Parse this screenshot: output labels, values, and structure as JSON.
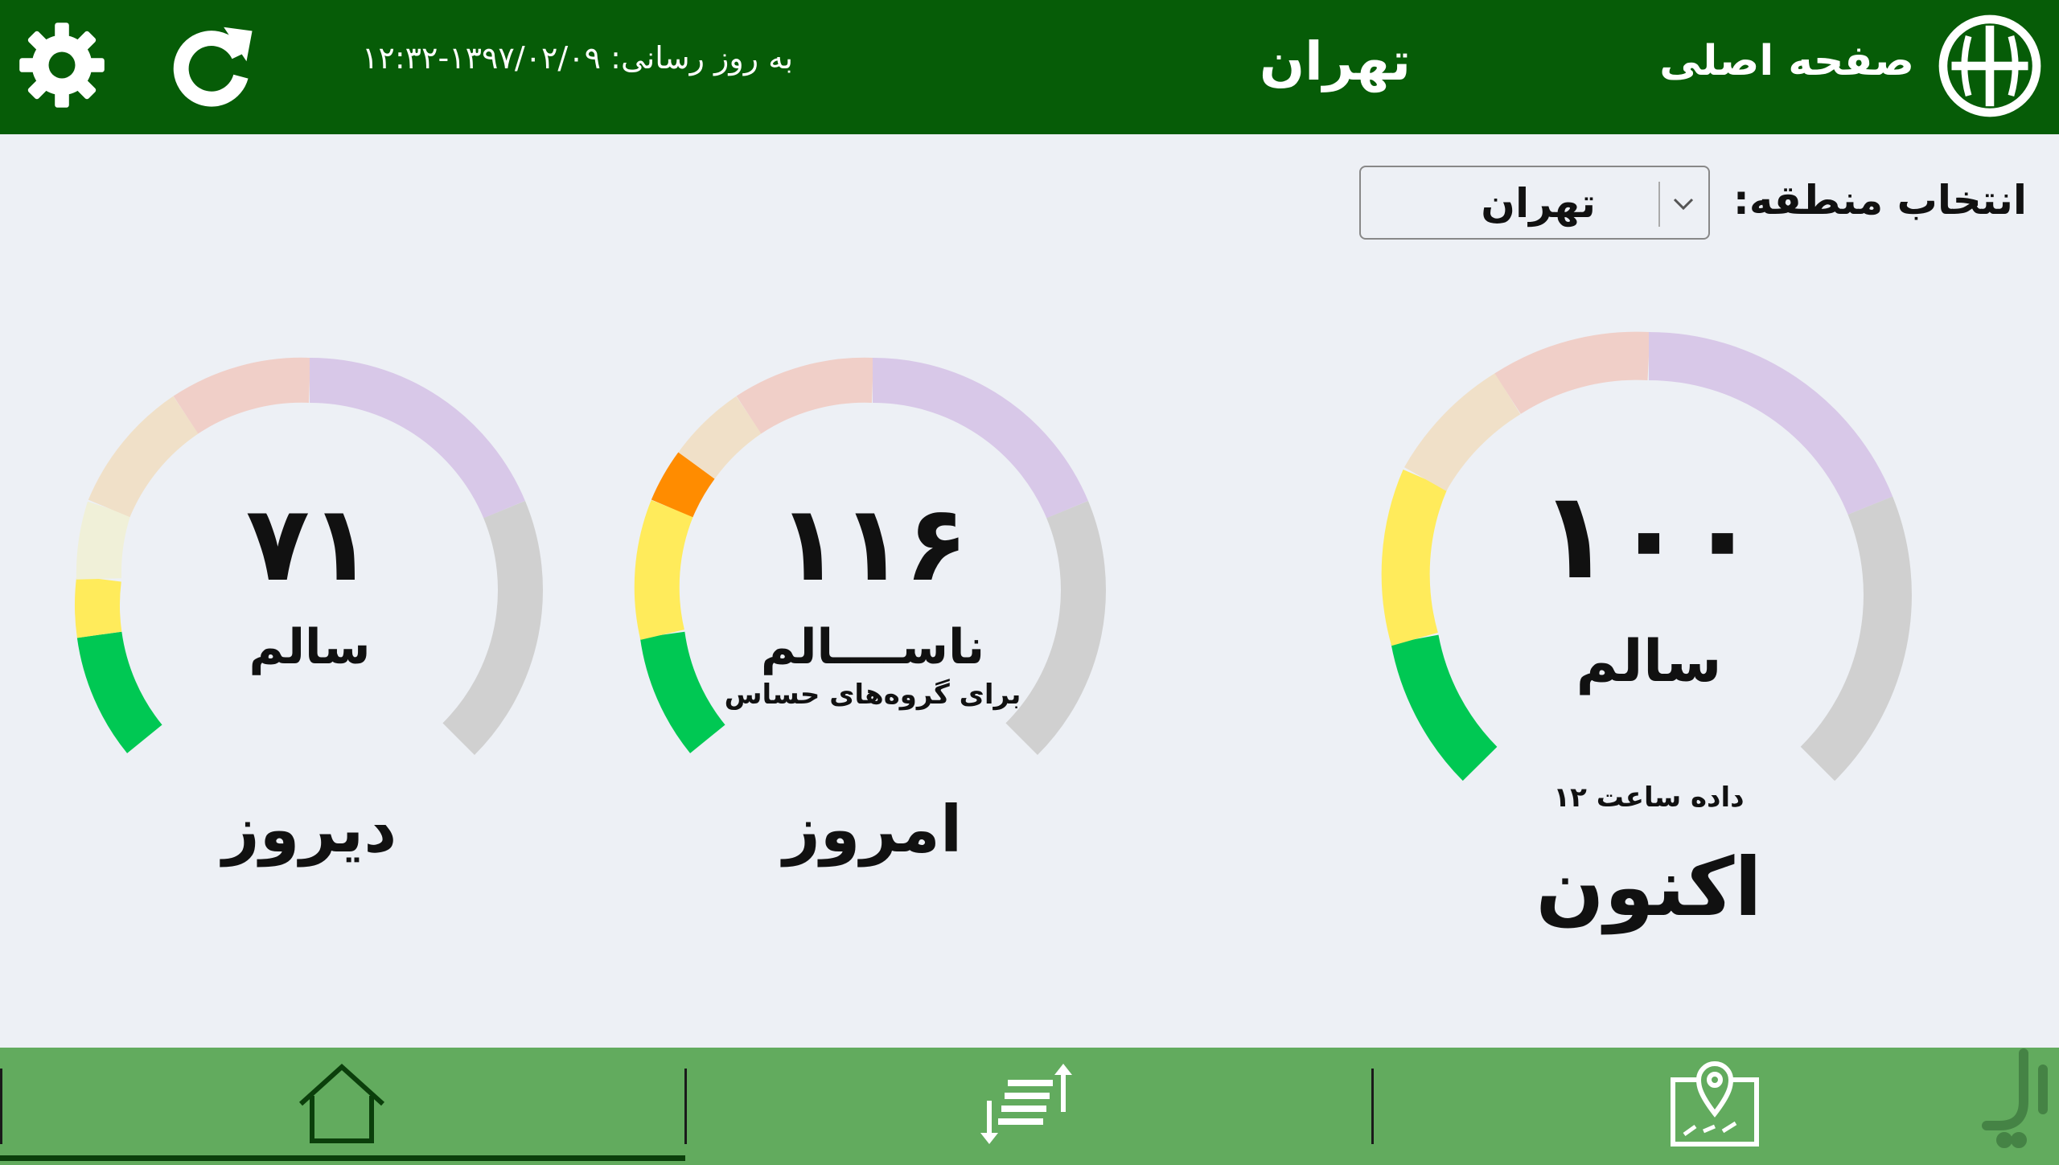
{
  "header": {
    "updated_label": "به روز رسانی: ۱۳۹۷/۰۲/۰۹-۱۲:۳۲",
    "city_title": "تهران",
    "home_label": "صفحه اصلی",
    "icons": [
      "gear-icon",
      "refresh-icon",
      "logo-icon"
    ],
    "color": "#065c07"
  },
  "region": {
    "label": "انتخاب منطقه:",
    "selected": "تهران"
  },
  "gauges": {
    "now": {
      "value": "۱۰۰",
      "status": "سالم",
      "data_note": "داده ساعت ۱۲",
      "label": "اکنون"
    },
    "today": {
      "value": "۱۱۶",
      "status": "ناســــالم",
      "sub": "برای گروه‌های حساس",
      "label": "امروز"
    },
    "yesterday": {
      "value": "۷۱",
      "status": "سالم",
      "label": "دیروز"
    }
  },
  "nav": {
    "items": [
      "home-icon",
      "sort-icon",
      "map-pin-icon"
    ],
    "color": "#62ab5e"
  },
  "palette": {
    "good": "#00c853",
    "moderate": "#ffeb5b",
    "usg": "#ff8c00",
    "usg_faded": "#f0e0c8",
    "unhealthy_faded": "#f0cfc8",
    "very_unhealthy_faded": "#d8c8e8",
    "hazardous_faded": "#d0d0d0",
    "pale_yellow": "#f0f0d8"
  }
}
